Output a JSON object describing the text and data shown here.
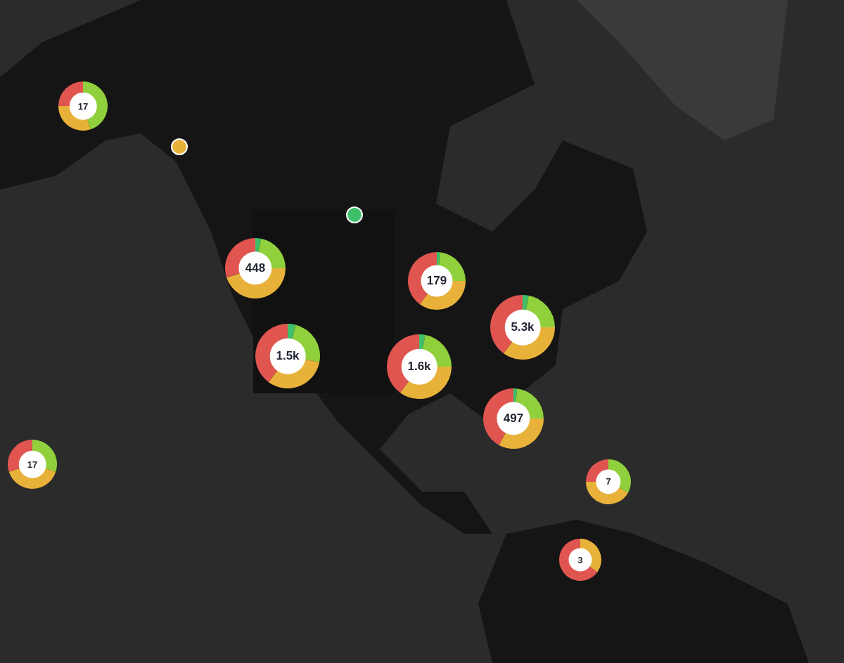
{
  "clusters": [
    {
      "count": "17"
    },
    {
      "count": "448"
    },
    {
      "count": "179"
    },
    {
      "count": "5.3k"
    },
    {
      "count": "1.5k"
    },
    {
      "count": "1.6k"
    },
    {
      "count": "497"
    },
    {
      "count": "17"
    },
    {
      "count": "7"
    },
    {
      "count": "3"
    }
  ],
  "points": [
    {
      "color": "#e8b23a"
    },
    {
      "color": "#3fbf6a"
    }
  ]
}
